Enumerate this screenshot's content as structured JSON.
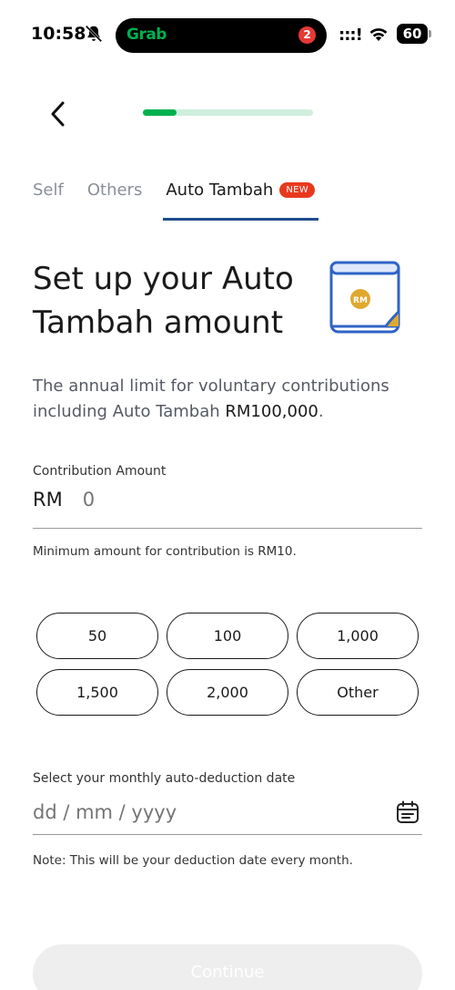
{
  "status_bar": {
    "time": "10:58",
    "island_app": "Grab",
    "notification_count": "2",
    "signal": ":::!",
    "battery": "60"
  },
  "header": {
    "progress": 0.2
  },
  "tabs": [
    {
      "label": "Self"
    },
    {
      "label": "Others"
    },
    {
      "label": "Auto Tambah",
      "badge": "NEW",
      "active": true
    }
  ],
  "headline": "Set up your Auto Tambah amount",
  "illustration": {
    "badge_text": "RM"
  },
  "description": {
    "prefix": "The annual limit for voluntary contributions including Auto Tambah ",
    "limit": "RM100,000",
    "suffix": "."
  },
  "contribution": {
    "label": "Contribution Amount",
    "currency": "RM",
    "placeholder": "0",
    "helper": "Minimum amount for contribution is RM10."
  },
  "amount_chips": [
    "50",
    "100",
    "1,000",
    "1,500",
    "2,000",
    "Other"
  ],
  "deduction_date": {
    "label": "Select your monthly auto-deduction date",
    "placeholder": "dd / mm / yyyy",
    "note": "Note: This will be your deduction date every month."
  },
  "continue_label": "Continue",
  "colors": {
    "brand_green": "#00b14f",
    "tab_underline": "#1e4c8c",
    "new_badge": "#e8391e"
  }
}
